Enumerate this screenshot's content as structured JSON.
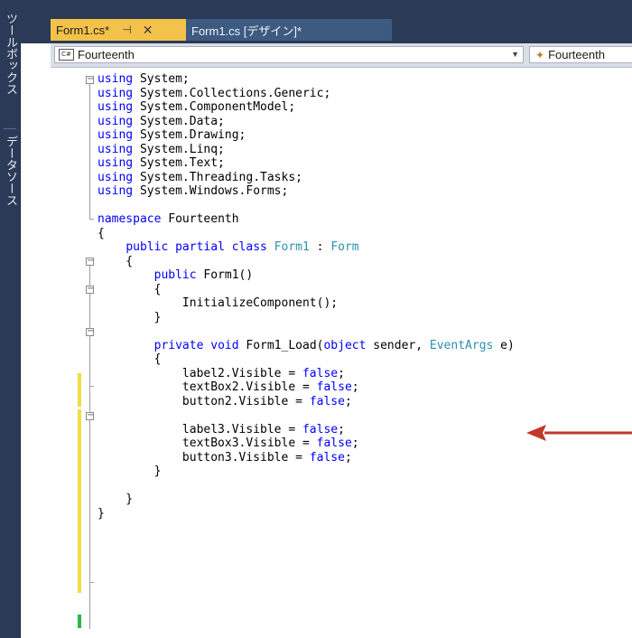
{
  "sidebar": {
    "toolbox_label": "ツールボックス",
    "datasource_label": "データソース"
  },
  "tabs": [
    {
      "label": "Form1.cs*",
      "pin": "⊣",
      "close": "✕"
    },
    {
      "label": "Form1.cs [デザイン]*"
    }
  ],
  "navbar": {
    "left_icon": "C#",
    "left_value": "Fourteenth",
    "right_value": "Fourteenth"
  },
  "code_lines": [
    [
      {
        "t": "using",
        "c": "kw"
      },
      {
        "t": " System;"
      }
    ],
    [
      {
        "t": "using",
        "c": "kw"
      },
      {
        "t": " System.Collections.Generic;"
      }
    ],
    [
      {
        "t": "using",
        "c": "kw"
      },
      {
        "t": " System.ComponentModel;"
      }
    ],
    [
      {
        "t": "using",
        "c": "kw"
      },
      {
        "t": " System.Data;"
      }
    ],
    [
      {
        "t": "using",
        "c": "kw"
      },
      {
        "t": " System.Drawing;"
      }
    ],
    [
      {
        "t": "using",
        "c": "kw"
      },
      {
        "t": " System.Linq;"
      }
    ],
    [
      {
        "t": "using",
        "c": "kw"
      },
      {
        "t": " System.Text;"
      }
    ],
    [
      {
        "t": "using",
        "c": "kw"
      },
      {
        "t": " System.Threading.Tasks;"
      }
    ],
    [
      {
        "t": "using",
        "c": "kw"
      },
      {
        "t": " System.Windows.Forms;"
      }
    ],
    [],
    [
      {
        "t": "namespace",
        "c": "kw"
      },
      {
        "t": " Fourteenth"
      }
    ],
    [
      {
        "t": "{"
      }
    ],
    [
      {
        "t": "    "
      },
      {
        "t": "public",
        "c": "kw"
      },
      {
        "t": " "
      },
      {
        "t": "partial",
        "c": "kw"
      },
      {
        "t": " "
      },
      {
        "t": "class",
        "c": "kw"
      },
      {
        "t": " "
      },
      {
        "t": "Form1",
        "c": "ty"
      },
      {
        "t": " : "
      },
      {
        "t": "Form",
        "c": "ty"
      }
    ],
    [
      {
        "t": "    {"
      }
    ],
    [
      {
        "t": "        "
      },
      {
        "t": "public",
        "c": "kw"
      },
      {
        "t": " Form1()"
      }
    ],
    [
      {
        "t": "        {"
      }
    ],
    [
      {
        "t": "            InitializeComponent();"
      }
    ],
    [
      {
        "t": "        }"
      }
    ],
    [],
    [
      {
        "t": "        "
      },
      {
        "t": "private",
        "c": "kw"
      },
      {
        "t": " "
      },
      {
        "t": "void",
        "c": "kw"
      },
      {
        "t": " Form1_Load("
      },
      {
        "t": "object",
        "c": "kw"
      },
      {
        "t": " sender, "
      },
      {
        "t": "EventArgs",
        "c": "ty"
      },
      {
        "t": " e)"
      }
    ],
    [
      {
        "t": "        {"
      }
    ],
    [
      {
        "t": "            label2.Visible = "
      },
      {
        "t": "false",
        "c": "kw"
      },
      {
        "t": ";"
      }
    ],
    [
      {
        "t": "            textBox2.Visible = "
      },
      {
        "t": "false",
        "c": "kw"
      },
      {
        "t": ";"
      }
    ],
    [
      {
        "t": "            button2.Visible = "
      },
      {
        "t": "false",
        "c": "kw"
      },
      {
        "t": ";"
      }
    ],
    [],
    [
      {
        "t": "            label3.Visible = "
      },
      {
        "t": "false",
        "c": "kw"
      },
      {
        "t": ";"
      }
    ],
    [
      {
        "t": "            textBox3.Visible = "
      },
      {
        "t": "false",
        "c": "kw"
      },
      {
        "t": ";"
      }
    ],
    [
      {
        "t": "            button3.Visible = "
      },
      {
        "t": "false",
        "c": "kw"
      },
      {
        "t": ";"
      }
    ],
    [
      {
        "t": "        }"
      }
    ],
    [],
    [
      {
        "t": "    }"
      }
    ],
    [
      {
        "t": "}"
      }
    ]
  ],
  "colors": {
    "keyword": "#0000ff",
    "type": "#2b91af",
    "annotation_arrow": "#c0392b"
  }
}
